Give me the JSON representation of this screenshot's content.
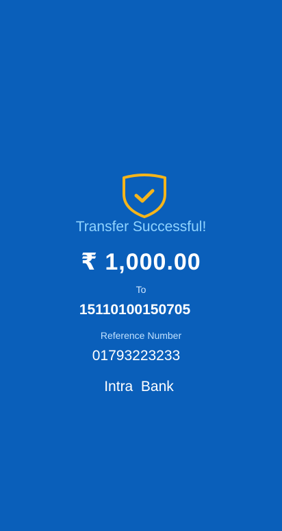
{
  "status": {
    "icon": "shield-check-icon",
    "title": "Transfer Successful!"
  },
  "transfer": {
    "amount": "₹ 1,000.00",
    "to_label": "To",
    "account_number": "15110100150705",
    "reference_label": "Reference Number",
    "reference_number": "01793223233",
    "transfer_type": "Intra  Bank"
  },
  "colors": {
    "background": "#0a5fba",
    "title": "#8fd3ff",
    "accent": "#f5b51b",
    "text": "#ffffff"
  }
}
